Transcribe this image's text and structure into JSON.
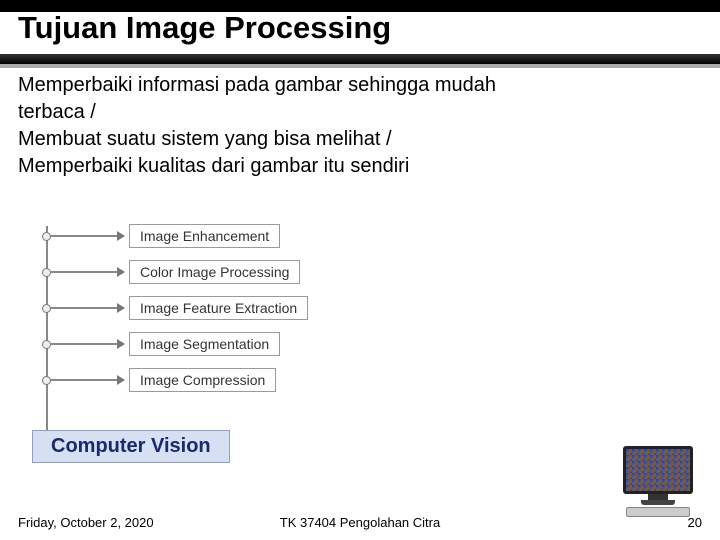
{
  "title": "Tujuan Image Processing",
  "body": {
    "line1": "Memperbaiki informasi pada gambar sehingga mudah",
    "line2": "terbaca /",
    "line3": "Membuat suatu sistem yang bisa melihat /",
    "line4": "Memperbaiki kualitas dari gambar itu sendiri"
  },
  "nodes": {
    "n0": "Image Enhancement",
    "n1": "Color Image Processing",
    "n2": "Image Feature Extraction",
    "n3": "Image Segmentation",
    "n4": "Image Compression"
  },
  "cv_label": "Computer Vision",
  "footer": {
    "date": "Friday, October 2, 2020",
    "course": "TK 37404 Pengolahan Citra",
    "page": "20"
  }
}
